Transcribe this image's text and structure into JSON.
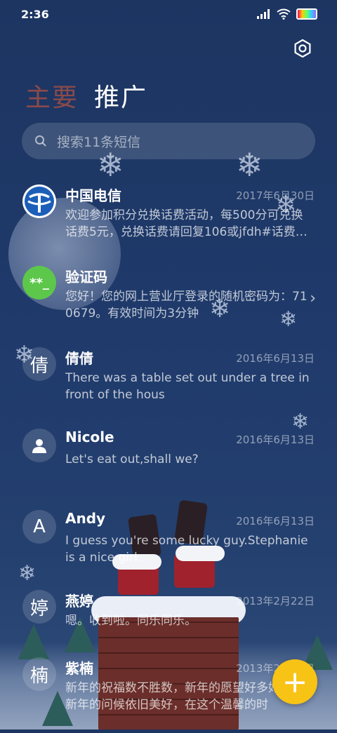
{
  "status": {
    "time": "2:36"
  },
  "tabs": [
    {
      "label": "主要"
    },
    {
      "label": "推广"
    }
  ],
  "search": {
    "placeholder": "搜索11条短信"
  },
  "messages": [
    {
      "avatar": "logo",
      "avatar_color": "#1c5fb8",
      "name": "中国电信",
      "date": "2017年6月30日",
      "preview": "欢迎参加积分兑换话费活动，每500分可兑换话费5元，兑换话费请回复106或jfdh#话费…"
    },
    {
      "avatar": "**_",
      "avatar_color": "#5cc74a",
      "name": "验证码",
      "date": "",
      "preview": "您好！您的网上营业厅登录的随机密码为：710679。有效时间为3分钟",
      "chevron": "›"
    },
    {
      "avatar": "倩",
      "name": "倩倩",
      "date": "2016年6月13日",
      "preview": "There was a table set out under a tree in front of the hous"
    },
    {
      "avatar": "person-icon",
      "name": "Nicole",
      "date": "2016年6月13日",
      "preview": "Let's eat out,shall we?"
    },
    {
      "avatar": "A",
      "name": "Andy",
      "date": "2016年6月13日",
      "preview": "I guess you're some lucky guy.Stephanie is a nice girl."
    },
    {
      "avatar": "婷",
      "name": "燕婷",
      "date": "2013年2月22日",
      "preview": "嗯。收到啦。同乐同乐。"
    },
    {
      "avatar": "楠",
      "name": "紫楠",
      "date": "2013年2月22日",
      "preview": "新年的祝福数不胜数，新年的愿望好多好多，新年的问候依旧美好，在这个温馨的时"
    }
  ],
  "fab": {
    "icon": "plus-icon",
    "label": "+",
    "color": "#f7c315"
  }
}
